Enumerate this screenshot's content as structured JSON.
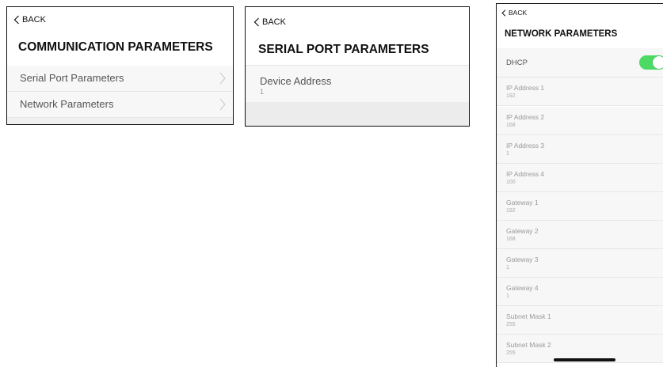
{
  "panel_comm": {
    "back_label": "BACK",
    "title": "COMMUNICATION PARAMETERS",
    "items": [
      {
        "label": "Serial Port Parameters"
      },
      {
        "label": "Network Parameters"
      }
    ]
  },
  "panel_serial": {
    "back_label": "BACK",
    "title": "SERIAL PORT PARAMETERS",
    "device_address": {
      "label": "Device Address",
      "value": "1"
    }
  },
  "panel_network": {
    "back_label": "BACK",
    "title": "NETWORK PARAMETERS",
    "dhcp": {
      "label": "DHCP",
      "enabled": true
    },
    "fields": [
      {
        "label": "IP Address 1",
        "value": "192"
      },
      {
        "label": "IP Address 2",
        "value": "168"
      },
      {
        "label": "IP Address 3",
        "value": "1"
      },
      {
        "label": "IP Address 4",
        "value": "100"
      },
      {
        "label": "Gateway 1",
        "value": "192"
      },
      {
        "label": "Gateway 2",
        "value": "168"
      },
      {
        "label": "Gateway 3",
        "value": "1"
      },
      {
        "label": "Gateway 4",
        "value": "1"
      },
      {
        "label": "Subnet Mask 1",
        "value": "255"
      },
      {
        "label": "Subnet Mask 2",
        "value": "255"
      }
    ]
  },
  "colors": {
    "toggle_on": "#4cd964"
  }
}
